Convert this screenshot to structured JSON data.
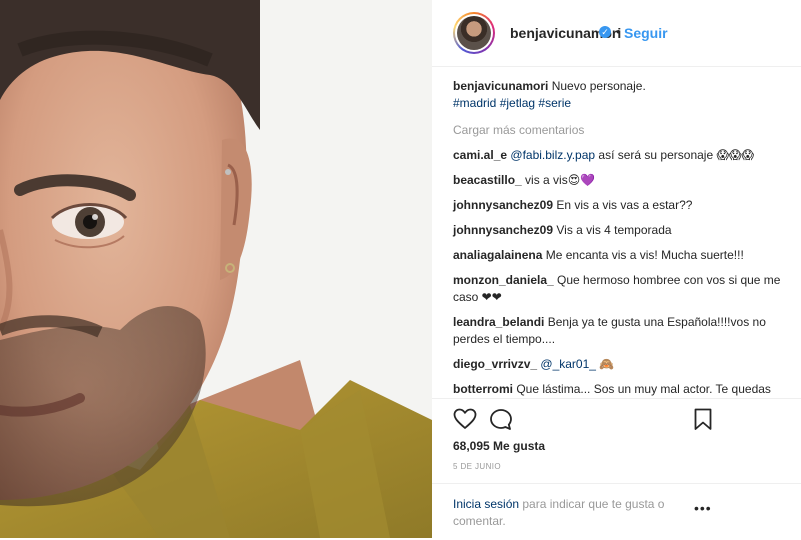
{
  "post": {
    "username": "benjavicunamori",
    "verified_glyph": "✓",
    "dot": "•",
    "follow_label": "Seguir",
    "caption": {
      "username": "benjavicunamori",
      "text": "Nuevo personaje.",
      "hashtags": [
        "#madrid",
        "#jetlag",
        "#serie"
      ]
    },
    "load_more_label": "Cargar más comentarios",
    "comments": [
      {
        "user": "cami.al_e",
        "mention": "@fabi.bilz.y.pap",
        "text": " así será su personaje 😱😱😱"
      },
      {
        "user": "beacastillo_",
        "text": "vis a vis😍💜"
      },
      {
        "user": "johnnysanchez09",
        "text": "En vis a vis vas a estar??"
      },
      {
        "user": "johnnysanchez09",
        "text": "Vis a vis 4 temporada"
      },
      {
        "user": "analiagalainena",
        "text": "Me encanta vis a vis! Mucha suerte!!!"
      },
      {
        "user": "monzon_daniela_",
        "text": "Que hermoso hombree con vos si que me caso ❤❤"
      },
      {
        "user": "leandra_belandi",
        "text": "Benja ya te gusta una Española!!!!vos no perdes el tiempo...."
      },
      {
        "user": "diego_vrrivzv_",
        "mention": "@_kar01_",
        "text": " 🙈"
      },
      {
        "user": "botterromi",
        "text": "Que lástima... Sos un muy mal actor. Te quedas con la misma cara"
      }
    ],
    "likes": "68,095 Me gusta",
    "date": "5 DE JUNIO",
    "login": {
      "link": "Inicia sesión",
      "text": " para indicar que te gusta o comentar."
    },
    "more_glyph": "•••"
  },
  "icons": {
    "like": "heart-icon",
    "comment": "comment-icon",
    "save": "bookmark-icon",
    "more": "more-options-icon"
  },
  "colors": {
    "link_blue": "#3897f0",
    "hashtag": "#003569",
    "muted": "#999999",
    "text": "#262626"
  }
}
